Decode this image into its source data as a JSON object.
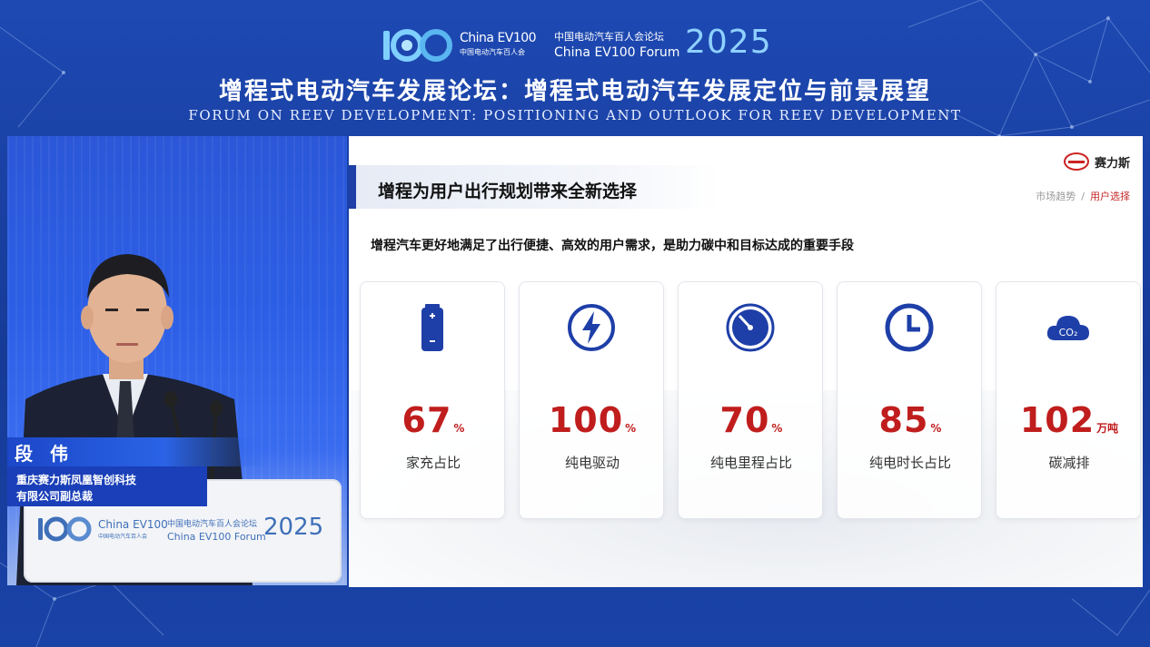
{
  "header": {
    "logo_en": "China EV100",
    "logo_cn": "中国电动汽车百人会",
    "forum_cn": "中国电动汽车百人会论坛",
    "forum_en": "China EV100 Forum",
    "year": "2025",
    "title_cn": "增程式电动汽车发展论坛：增程式电动汽车发展定位与前景展望",
    "title_en": "FORUM ON REEV DEVELOPMENT: POSITIONING AND OUTLOOK FOR REEV DEVELOPMENT"
  },
  "speaker": {
    "name": "段 伟",
    "title_line1": "重庆赛力斯凤凰智创科技",
    "title_line2": "有限公司副总裁",
    "podium": {
      "logo_en": "China EV100",
      "logo_cn": "中国电动汽车百人会",
      "forum_cn": "中国电动汽车百人会论坛",
      "forum_en": "China EV100 Forum",
      "year": "2025"
    }
  },
  "slide": {
    "brand": "赛力斯",
    "heading": "增程为用户出行规划带来全新选择",
    "breadcrumb": [
      "市场趋势",
      "用户选择"
    ],
    "breadcrumb_sep": "/",
    "subtitle": "增程汽车更好地满足了出行便捷、高效的用户需求，是助力碳中和目标达成的重要手段",
    "colors": {
      "accent_blue": "#1e3fa8",
      "value_red": "#c01d1d"
    },
    "cards": [
      {
        "icon": "battery-icon",
        "value": "67",
        "unit": "%",
        "label": "家充占比"
      },
      {
        "icon": "lightning-icon",
        "value": "100",
        "unit": "%",
        "label": "纯电驱动"
      },
      {
        "icon": "speedometer-icon",
        "value": "70",
        "unit": "%",
        "label": "纯电里程占比"
      },
      {
        "icon": "clock-icon",
        "value": "85",
        "unit": "%",
        "label": "纯电时长占比"
      },
      {
        "icon": "co2-cloud-icon",
        "value": "102",
        "unit": "万吨",
        "label": "碳减排"
      }
    ]
  }
}
